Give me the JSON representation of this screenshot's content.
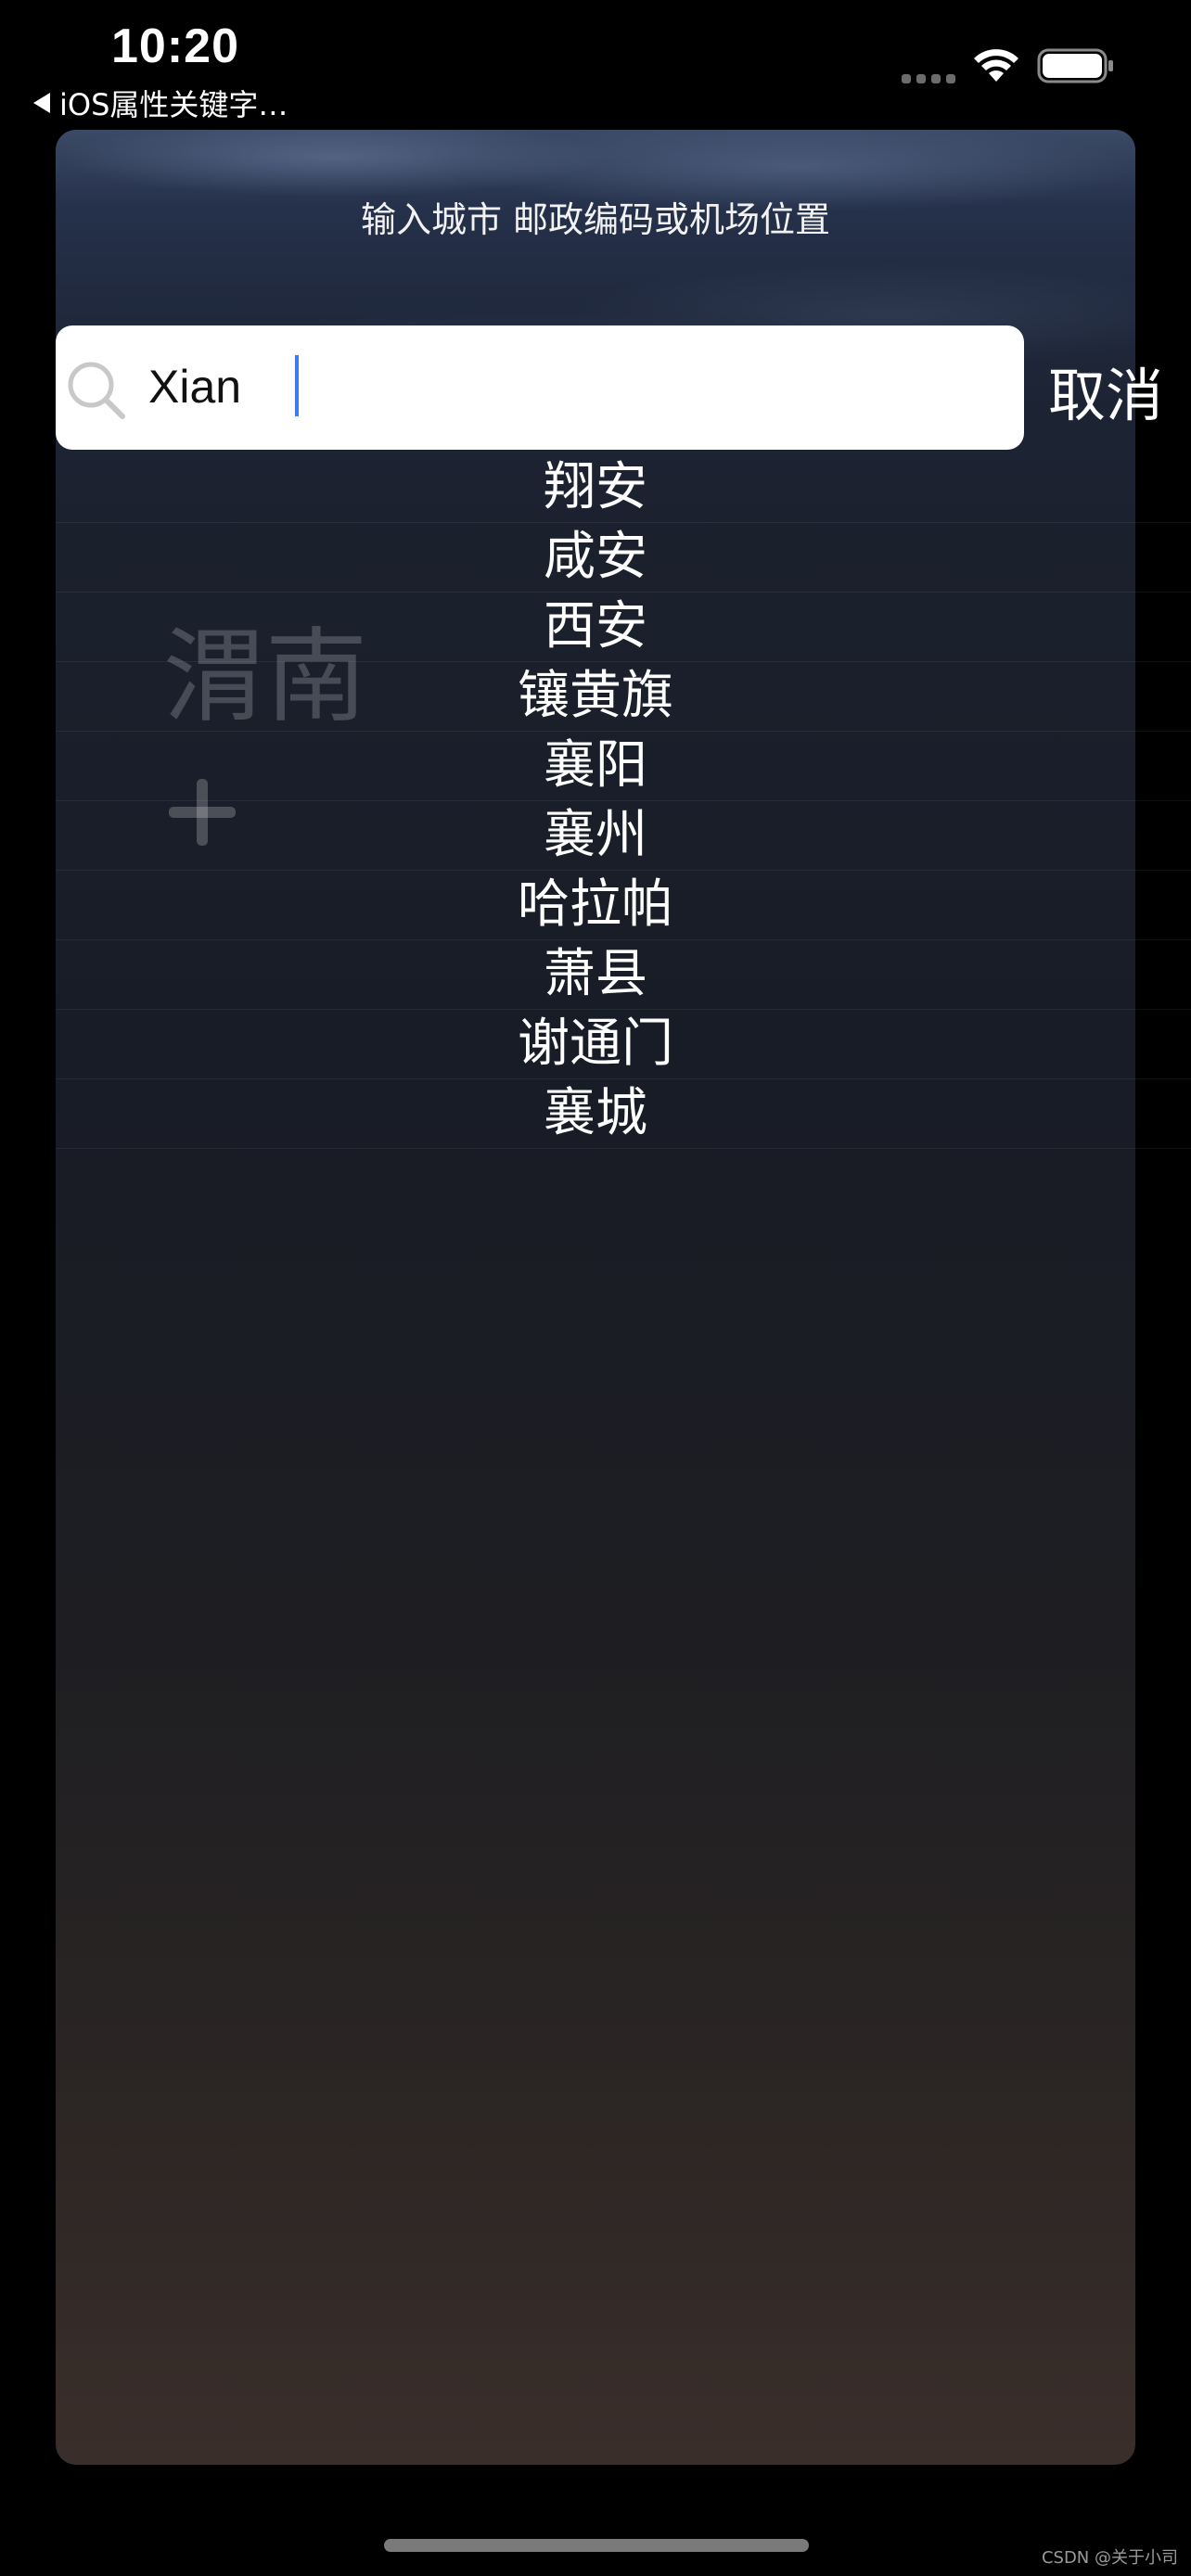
{
  "status_bar": {
    "time": "10:20",
    "back_label": "iOS属性关键字…"
  },
  "search_panel": {
    "prompt": "输入城市 邮政编码或机场位置",
    "search_value": "Xian",
    "cancel_label": "取消"
  },
  "background_list": {
    "city": "渭南"
  },
  "results": [
    "翔安",
    "咸安",
    "西安",
    "镶黄旗",
    "襄阳",
    "襄州",
    "哈拉帕",
    "萧县",
    "谢通门",
    "襄城"
  ],
  "watermark": "CSDN @关于小司",
  "colors": {
    "caret": "#3d7cf4",
    "search_bg": "#ffffff",
    "page_bg": "#000000"
  }
}
